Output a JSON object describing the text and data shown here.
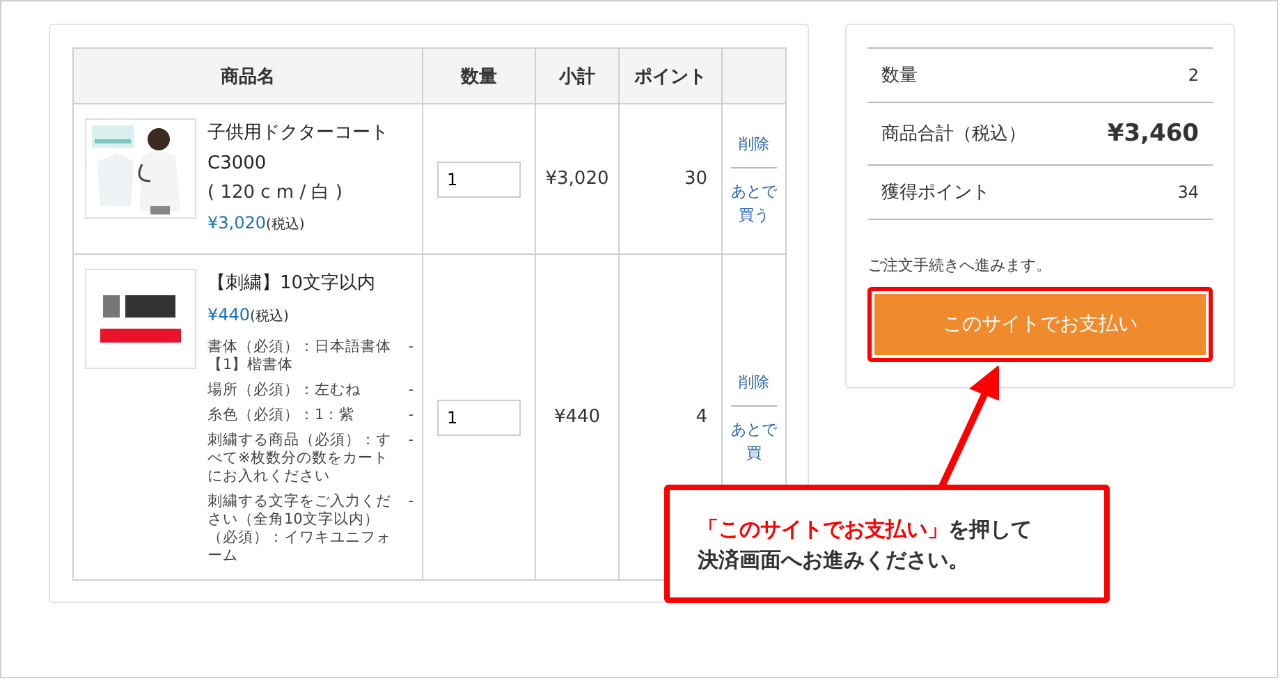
{
  "cart": {
    "columns": [
      "商品名",
      "数量",
      "小計",
      "ポイント",
      ""
    ],
    "rows": [
      {
        "name": "子供用ドクターコート C3000",
        "variant": "( 120 c m / 白 )",
        "price": "¥3,020",
        "tax": "(税込)",
        "options": [],
        "quantity": "1",
        "subtotal": "¥3,020",
        "points": "30",
        "delete": "削除",
        "later": "あとで買う"
      },
      {
        "name": "【刺繍】10文字以内",
        "variant": "",
        "price": "¥440",
        "tax": "(税込)",
        "options": [
          {
            "label": "書体（必須）：日本語書体【1】楷書体",
            "value": "-"
          },
          {
            "label": "場所（必須）：左むね",
            "value": "-"
          },
          {
            "label": "糸色（必須）：1：紫",
            "value": "-"
          },
          {
            "label": "刺繍する商品（必須）：すべて※枚数分の数をカートにお入れください",
            "value": "-"
          },
          {
            "label": "刺繍する文字をご入力ください（全角10文字以内）（必須）：イワキユニフォーム",
            "value": "-"
          }
        ],
        "quantity": "1",
        "subtotal": "¥440",
        "points": "4",
        "delete": "削除",
        "later": "あとで買"
      }
    ]
  },
  "summary": {
    "rows": [
      {
        "kind": "plain",
        "label": "数量",
        "value": "2"
      },
      {
        "kind": "total",
        "label": "商品合計（税込）",
        "value": "¥3,460"
      },
      {
        "kind": "plain",
        "label": "獲得ポイント",
        "value": "34"
      }
    ],
    "note": "ご注文手続きへ進みます。",
    "pay_button": "このサイトでお支払い"
  },
  "callout": {
    "highlight": "「このサイトでお支払い」",
    "line_1": "を押して",
    "line_2": "決済画面へお進みください。"
  }
}
